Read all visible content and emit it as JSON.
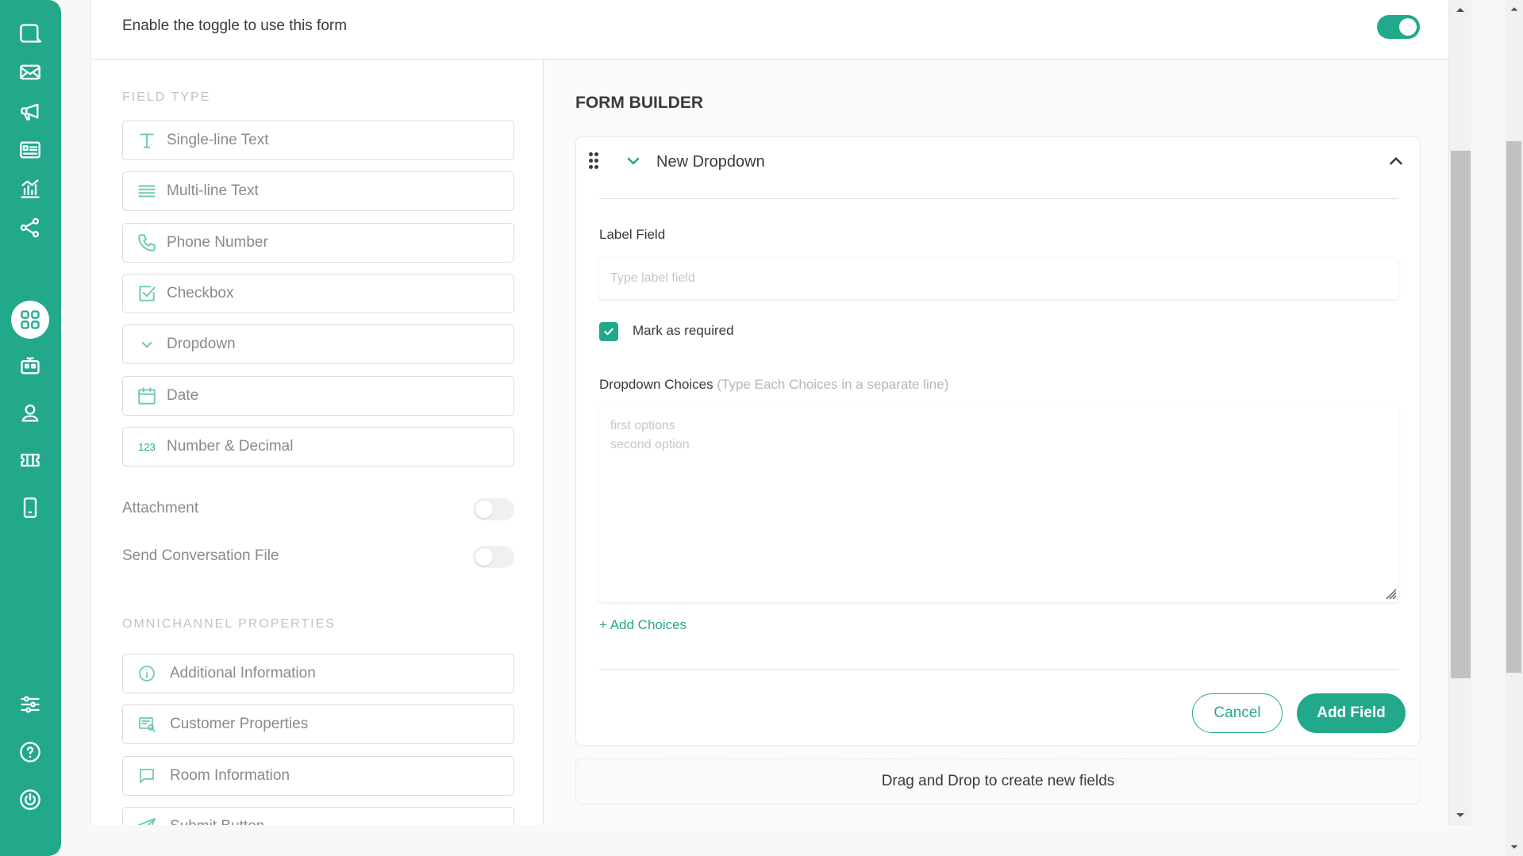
{
  "header": {
    "enable_text": "Enable the toggle to use this form",
    "toggle_on": true
  },
  "sidebar": {
    "items": [
      {
        "icon": "chat-icon"
      },
      {
        "icon": "mail-icon"
      },
      {
        "icon": "megaphone-icon"
      },
      {
        "icon": "contact-card-icon"
      },
      {
        "icon": "analytics-icon"
      },
      {
        "icon": "share-nodes-icon"
      },
      {
        "icon": "apps-grid-icon",
        "active": true
      },
      {
        "icon": "bot-icon"
      },
      {
        "icon": "user-icon"
      },
      {
        "icon": "ticket-icon"
      },
      {
        "icon": "mobile-icon"
      },
      {
        "icon": "settings-sliders-icon"
      },
      {
        "icon": "help-icon"
      },
      {
        "icon": "power-icon"
      }
    ]
  },
  "field_type": {
    "title": "FIELD TYPE",
    "items": [
      {
        "label": "Single-line Text",
        "icon": "text-t-icon"
      },
      {
        "label": "Multi-line Text",
        "icon": "lines-icon"
      },
      {
        "label": "Phone Number",
        "icon": "phone-icon"
      },
      {
        "label": "Checkbox",
        "icon": "checkbox-icon"
      },
      {
        "label": "Dropdown",
        "icon": "chevron-down-icon"
      },
      {
        "label": "Date",
        "icon": "calendar-icon"
      },
      {
        "label": "Number & Decimal",
        "icon": "numbers-icon",
        "glyph": "123"
      }
    ],
    "toggles": [
      {
        "label": "Attachment",
        "on": false
      },
      {
        "label": "Send Conversation File",
        "on": false
      }
    ]
  },
  "omnichannel": {
    "title": "OMNICHANNEL PROPERTIES",
    "items": [
      {
        "label": "Additional Information",
        "icon": "info-icon"
      },
      {
        "label": "Customer Properties",
        "icon": "customer-card-icon"
      },
      {
        "label": "Room Information",
        "icon": "chat-bubble-icon"
      },
      {
        "label": "Submit Button",
        "icon": "send-icon"
      }
    ]
  },
  "form_builder": {
    "title": "FORM BUILDER",
    "card": {
      "name": "New Dropdown",
      "label_field": {
        "label": "Label Field",
        "placeholder": "Type label field",
        "value": ""
      },
      "required": {
        "label": "Mark as required",
        "checked": true
      },
      "choices": {
        "label": "Dropdown Choices",
        "hint": "(Type Each Choices in a separate line)",
        "placeholder": "first options\nsecond option",
        "value": ""
      },
      "add_choices": "+ Add Choices",
      "cancel": "Cancel",
      "add_field": "Add Field"
    },
    "dropzone": "Drag and Drop to create new fields"
  },
  "colors": {
    "accent": "#22a98c",
    "sidebar_bg": "#22a98c",
    "muted_text": "#8a8a8a"
  }
}
